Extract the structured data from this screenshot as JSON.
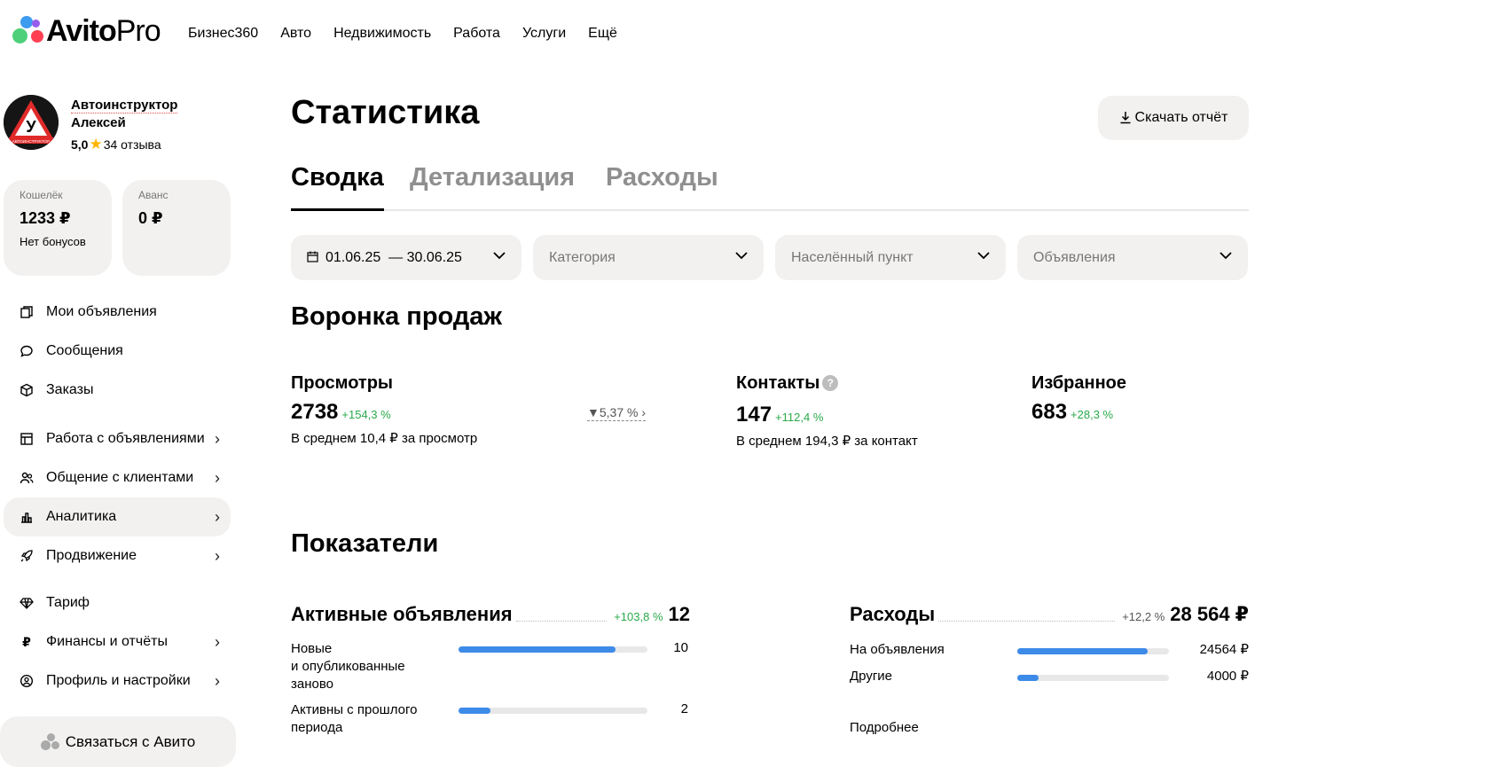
{
  "header": {
    "logo_main": "Avito",
    "logo_pro": "Pro",
    "nav": [
      "Бизнес360",
      "Авто",
      "Недвижимость",
      "Работа",
      "Услуги",
      "Ещё"
    ]
  },
  "profile": {
    "name_line1": "Автоинструктор",
    "name_line2": "Алексей",
    "rating": "5,0",
    "reviews": "34 отзыва",
    "avatar_letter": "У",
    "avatar_caption": "АВТОИНСТРУКТОР"
  },
  "wallet": {
    "label": "Кошелёк",
    "amount": "1233 ₽",
    "bonus": "Нет бонусов"
  },
  "advance": {
    "label": "Аванс",
    "amount": "0 ₽"
  },
  "sidebar": {
    "items": [
      {
        "label": "Мои объявления",
        "icon": "listings-icon"
      },
      {
        "label": "Сообщения",
        "icon": "chat-icon"
      },
      {
        "label": "Заказы",
        "icon": "box-icon"
      },
      {
        "label": "Работа с объявлениями",
        "icon": "layout-icon"
      },
      {
        "label": "Общение с клиентами",
        "icon": "users-icon"
      },
      {
        "label": "Аналитика",
        "icon": "bar-chart-icon"
      },
      {
        "label": "Продвижение",
        "icon": "rocket-icon"
      },
      {
        "label": "Тариф",
        "icon": "diamond-icon"
      },
      {
        "label": "Финансы и отчёты",
        "icon": "ruble-icon"
      },
      {
        "label": "Профиль и настройки",
        "icon": "user-circle-icon"
      }
    ],
    "contact": "Связаться с Авито"
  },
  "main": {
    "title": "Статистика",
    "download": "Скачать отчёт",
    "tabs": [
      "Сводка",
      "Детализация",
      "Расходы"
    ],
    "filters": {
      "date": "01.06.25  — 30.06.25",
      "category": "Категория",
      "city": "Населённый пункт",
      "ads": "Объявления"
    }
  },
  "funnel": {
    "title": "Воронка продаж",
    "views": {
      "title": "Просмотры",
      "value": "2738",
      "delta": "+154,3 %",
      "sub": "В среднем 10,4 ₽ за просмотр",
      "conversion": "5,37 %"
    },
    "contacts": {
      "title": "Контакты",
      "help": "?",
      "value": "147",
      "delta": "+112,4 %",
      "sub": "В среднем 194,3 ₽ за контакт"
    },
    "favorites": {
      "title": "Избранное",
      "value": "683",
      "delta": "+28,3 %"
    }
  },
  "indicators": {
    "title": "Показатели",
    "active": {
      "title": "Активные объявления",
      "delta": "+103,8 %",
      "value": "12",
      "rows": [
        {
          "label_lines": [
            "Новые",
            "и опубликованные",
            "заново"
          ],
          "value": "10",
          "fraction": 0.83
        },
        {
          "label_lines": [
            "Активны с прошлого",
            "периода"
          ],
          "value": "2",
          "fraction": 0.17
        }
      ]
    },
    "expenses": {
      "title": "Расходы",
      "delta": "+12,2 %",
      "value": "28 564 ₽",
      "rows": [
        {
          "label": "На объявления",
          "value": "24564 ₽",
          "fraction": 0.86
        },
        {
          "label": "Другие",
          "value": "4000 ₽",
          "fraction": 0.14
        }
      ],
      "more": "Подробнее"
    }
  },
  "colors": {
    "accent_blue": "#3d8be8",
    "positive_green": "#2aa94a",
    "card_bg": "#f2f1f0"
  }
}
